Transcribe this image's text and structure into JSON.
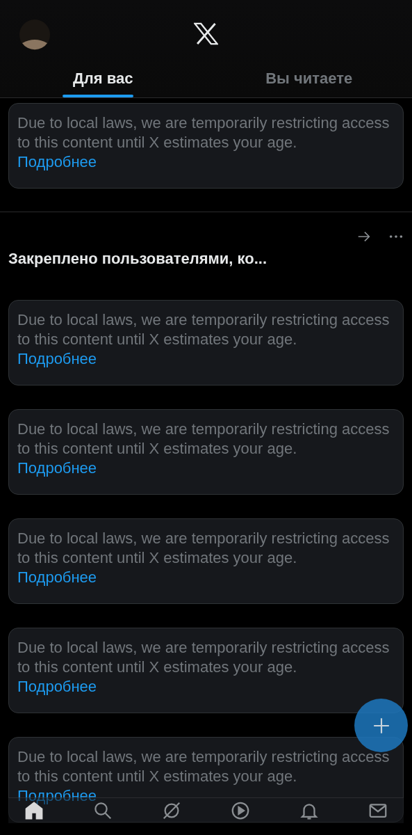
{
  "tabs": [
    {
      "label": "Для вас",
      "selected": true
    },
    {
      "label": "Вы читаете",
      "selected": false
    }
  ],
  "feed_top": {
    "notice": "Due to local laws, we are temporarily restricting access to this content until X estimates your age.",
    "link": "Подробнее"
  },
  "pinned_section": {
    "title": "Закреплено пользователями, ко...",
    "cards": [
      {
        "notice": "Due to local laws, we are temporarily restricting access to this content until X estimates your age.",
        "link": "Подробнее"
      },
      {
        "notice": "Due to local laws, we are temporarily restricting access to this content until X estimates your age.",
        "link": "Подробнее"
      },
      {
        "notice": "Due to local laws, we are temporarily restricting access to this content until X estimates your age.",
        "link": "Подробнее"
      },
      {
        "notice": "Due to local laws, we are temporarily restricting access to this content until X estimates your age.",
        "link": "Подробнее"
      },
      {
        "notice": "Due to local laws, we are temporarily restricting access to this content until X estimates your age.",
        "link": "Подробнее"
      }
    ]
  },
  "bottom_nav": [
    {
      "kind": "home",
      "selected": true
    },
    {
      "kind": "search",
      "selected": false
    },
    {
      "kind": "grok",
      "selected": false
    },
    {
      "kind": "video",
      "selected": false
    },
    {
      "kind": "notifications",
      "selected": false
    },
    {
      "kind": "messages",
      "selected": false
    }
  ]
}
